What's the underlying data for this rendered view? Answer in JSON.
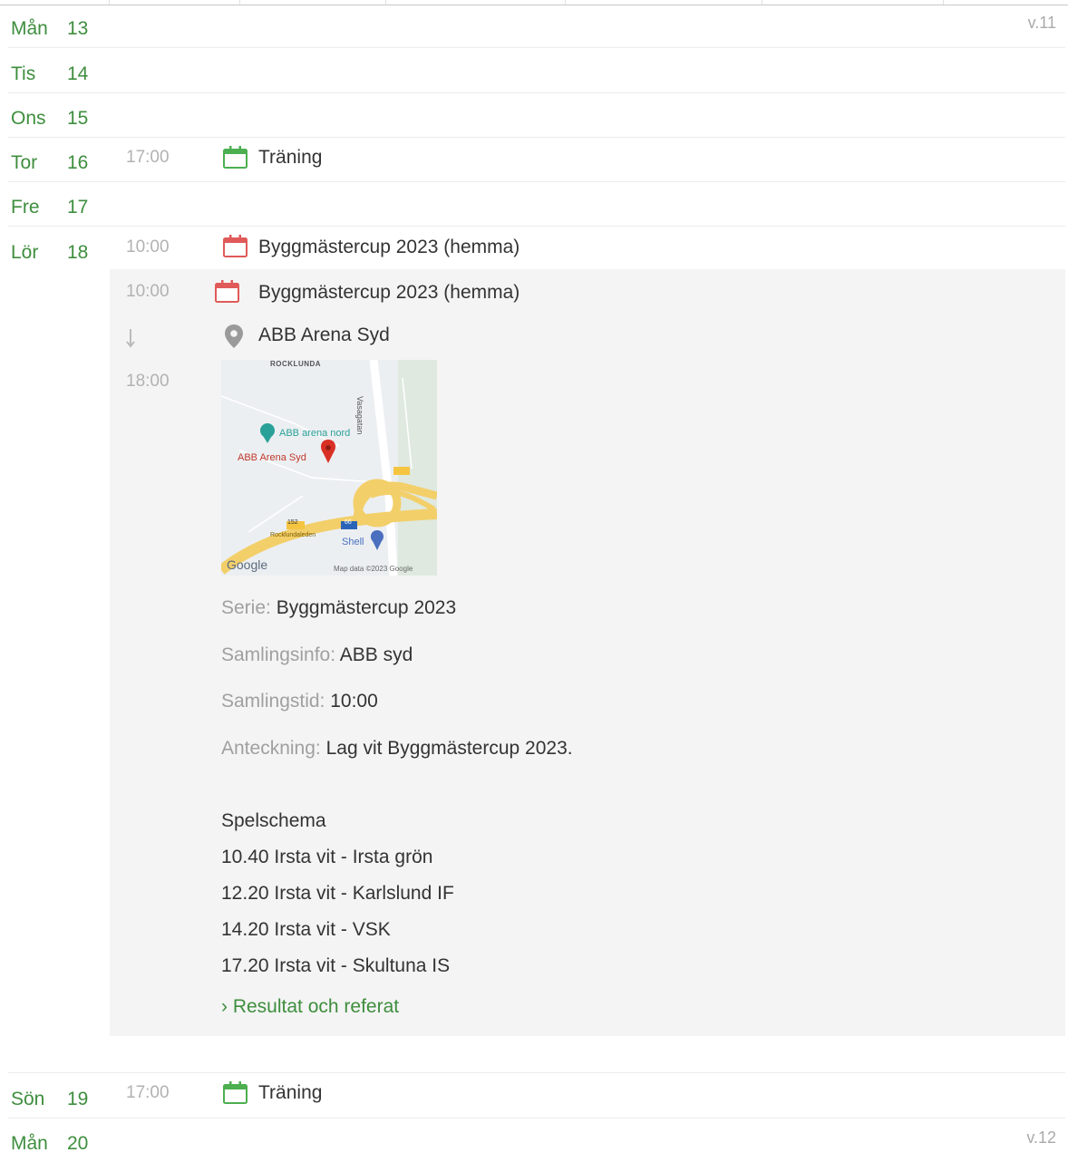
{
  "days": [
    {
      "day": "Mån",
      "date": "13",
      "week": "v.11"
    },
    {
      "day": "Tis",
      "date": "14"
    },
    {
      "day": "Ons",
      "date": "15"
    },
    {
      "day": "Tor",
      "date": "16",
      "time": "17:00",
      "title": "Träning"
    },
    {
      "day": "Fre",
      "date": "17"
    },
    {
      "day": "Lör",
      "date": "18",
      "time": "10:00",
      "title": "Byggmästercup 2023 (hemma)"
    },
    {
      "day": "Sön",
      "date": "19",
      "time": "17:00",
      "title": "Träning"
    },
    {
      "day": "Mån",
      "date": "20",
      "week": "v.12"
    }
  ],
  "detail": {
    "start_time": "10:00",
    "end_time": "18:00",
    "title": "Byggmästercup 2023 (hemma)",
    "location": "ABB Arena Syd",
    "map": {
      "area_label": "ROCKLUNDA",
      "road_label": "Vasagatan",
      "poi_label": "ABB arena nord",
      "pin_label": "ABB Arena Syd",
      "shop_label": "Shell",
      "route_number": "152",
      "route_number_2": "66",
      "street_label": "Rocklundaleden",
      "logo_text": "Google",
      "attribution": "Map data ©2023 Google"
    },
    "serie_label": "Serie:",
    "serie_value": "Byggmästercup 2023",
    "samlingsinfo_label": "Samlingsinfo:",
    "samlingsinfo_value": "ABB syd",
    "samlingstid_label": "Samlingstid:",
    "samlingstid_value": "10:00",
    "anteckning_label": "Anteckning:",
    "anteckning_value": "Lag vit Byggmästercup 2023.",
    "schedule_heading": "Spelschema",
    "schedule": [
      "10.40 Irsta vit - Irsta grön",
      "12.20 Irsta vit - Karlslund IF",
      "14.20 Irsta vit - VSK",
      "17.20 Irsta vit - Skultuna IS"
    ],
    "result_link": "› Resultat och referat"
  },
  "colors": {
    "accent": "#3e8e3e",
    "training_icon": "#4caf50",
    "match_icon": "#e05a5a",
    "muted": "#b2b2b2",
    "detail_bg": "#f4f4f4"
  }
}
